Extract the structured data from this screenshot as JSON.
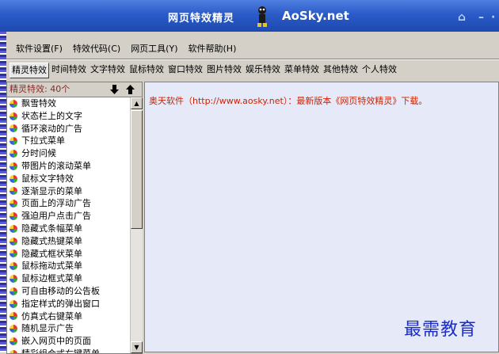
{
  "titlebar": {
    "app_title": "网页特效精灵",
    "brand": "AoSky.net",
    "home_icon": "home-icon",
    "minimize_icon": "minimize-icon"
  },
  "menu": [
    {
      "label": "软件设置(F)"
    },
    {
      "label": "特效代码(C)"
    },
    {
      "label": "网页工具(Y)"
    },
    {
      "label": "软件帮助(H)"
    }
  ],
  "tabs": [
    {
      "label": "精灵特效",
      "active": true
    },
    {
      "label": "时间特效"
    },
    {
      "label": "文字特效"
    },
    {
      "label": "鼠标特效"
    },
    {
      "label": "窗口特效"
    },
    {
      "label": "图片特效"
    },
    {
      "label": "娱乐特效"
    },
    {
      "label": "菜单特效"
    },
    {
      "label": "其他特效"
    },
    {
      "label": "个人特效"
    }
  ],
  "panel": {
    "header": "精灵特效: 40个"
  },
  "items": [
    "飘雪特效",
    "状态栏上的文字",
    "循环滚动的广告",
    "下拉式菜单",
    "分时问候",
    "带图片的滚动菜单",
    "鼠标文字特效",
    "逐渐显示的菜单",
    "页面上的浮动广告",
    "强迫用户点击广告",
    "隐藏式条幅菜单",
    "隐藏式热键菜单",
    "隐藏式框状菜单",
    "鼠标拖动式菜单",
    "鼠标边框式菜单",
    "可自由移动的公告板",
    "指定样式的弹出窗口",
    "仿真式右键菜单",
    "随机显示广告",
    "嵌入网页中的页面",
    "精彩组合式右键菜单"
  ],
  "content": {
    "notice": "奥天软件（http://www.aosky.net）：最新版本《网页特效精灵》下载。"
  },
  "watermark": "最需教育"
}
